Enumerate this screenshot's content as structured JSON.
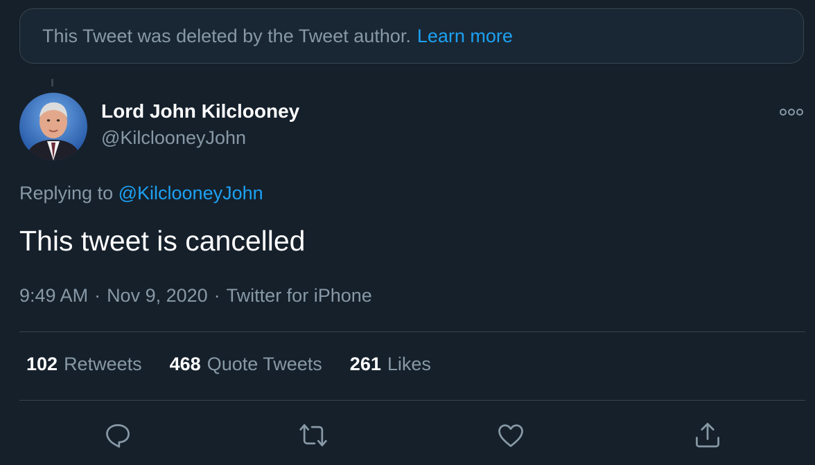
{
  "banner": {
    "text": "This Tweet was deleted by the Tweet author.",
    "link": "Learn more"
  },
  "author": {
    "display_name": "Lord John Kilclooney",
    "handle": "@KilclooneyJohn"
  },
  "reply": {
    "prefix": "Replying to",
    "mention": "@KilclooneyJohn"
  },
  "tweet": {
    "text": "This tweet is cancelled",
    "time": "9:49 AM",
    "date": "Nov 9, 2020",
    "source": "Twitter for iPhone",
    "separator": "·"
  },
  "stats": {
    "retweets_count": "102",
    "retweets_label": "Retweets",
    "quote_count": "468",
    "quote_label": "Quote Tweets",
    "likes_count": "261",
    "likes_label": "Likes"
  },
  "icons": {
    "more": "more-options-icon",
    "reply": "reply-icon",
    "retweet": "retweet-icon",
    "like": "like-icon",
    "share": "share-icon"
  },
  "colors": {
    "background": "#15202b",
    "accent": "#1da1f2",
    "secondary_text": "#8899a6",
    "border": "#38444d"
  }
}
